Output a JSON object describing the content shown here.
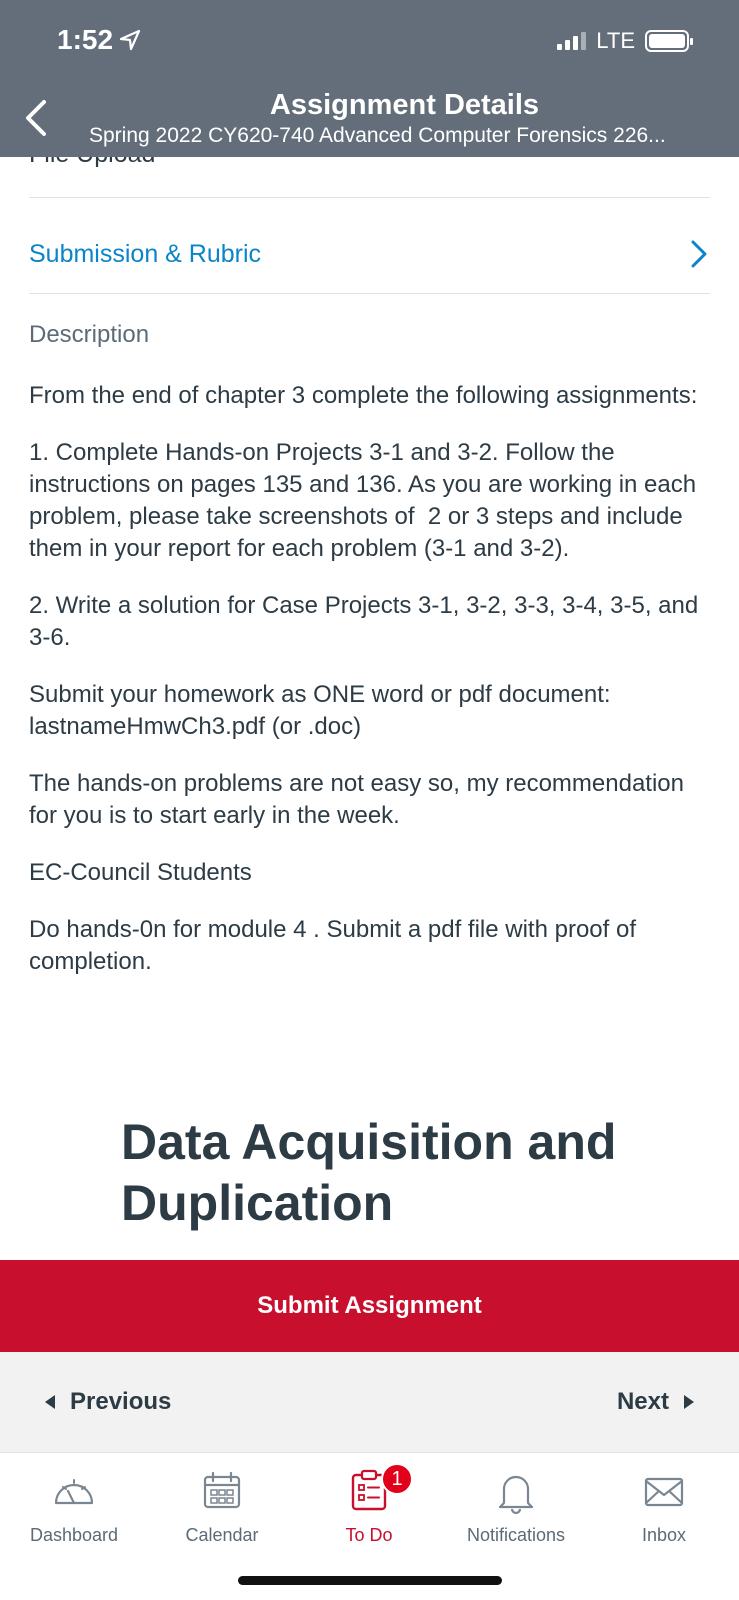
{
  "status_bar": {
    "time": "1:52",
    "network": "LTE"
  },
  "header": {
    "title": "Assignment Details",
    "subtitle": "Spring 2022 CY620-740 Advanced Computer Forensics 226..."
  },
  "content": {
    "cut_off_row": "File Upload",
    "submission_link": "Submission & Rubric",
    "description_title": "Description",
    "description_paragraphs": [
      "From the end of chapter 3 complete the following assignments:",
      "1. Complete Hands-on Projects 3-1 and 3-2. Follow the instructions on pages 135 and 136. As you are working in each problem, please take screenshots of  2 or 3 steps and include them in your report for each problem (3-1 and 3-2).",
      "2. Write a solution for Case Projects 3-1, 3-2, 3-3, 3-4, 3-5, and 3-6.",
      "Submit your homework as ONE word or pdf document: lastnameHmwCh3.pdf (or .doc)",
      "The hands-on problems are not easy so, my recommendation for you is to start early in the week.",
      "EC-Council Students",
      "Do hands-0n for module 4 . Submit a pdf file with proof of completion."
    ],
    "embedded_heading": "Data Acquisition and Duplication"
  },
  "actions": {
    "submit_label": "Submit Assignment",
    "previous_label": "Previous",
    "next_label": "Next"
  },
  "tabbar": {
    "tabs": [
      {
        "label": "Dashboard",
        "icon": "dashboard-icon"
      },
      {
        "label": "Calendar",
        "icon": "calendar-icon"
      },
      {
        "label": "To Do",
        "icon": "todo-icon",
        "active": true,
        "badge": "1"
      },
      {
        "label": "Notifications",
        "icon": "bell-icon"
      },
      {
        "label": "Inbox",
        "icon": "envelope-icon"
      }
    ]
  },
  "colors": {
    "header_bg": "#636e7a",
    "link": "#0b84c9",
    "accent_red": "#c8102e",
    "text": "#2d3b45",
    "muted": "#5b6b78"
  }
}
